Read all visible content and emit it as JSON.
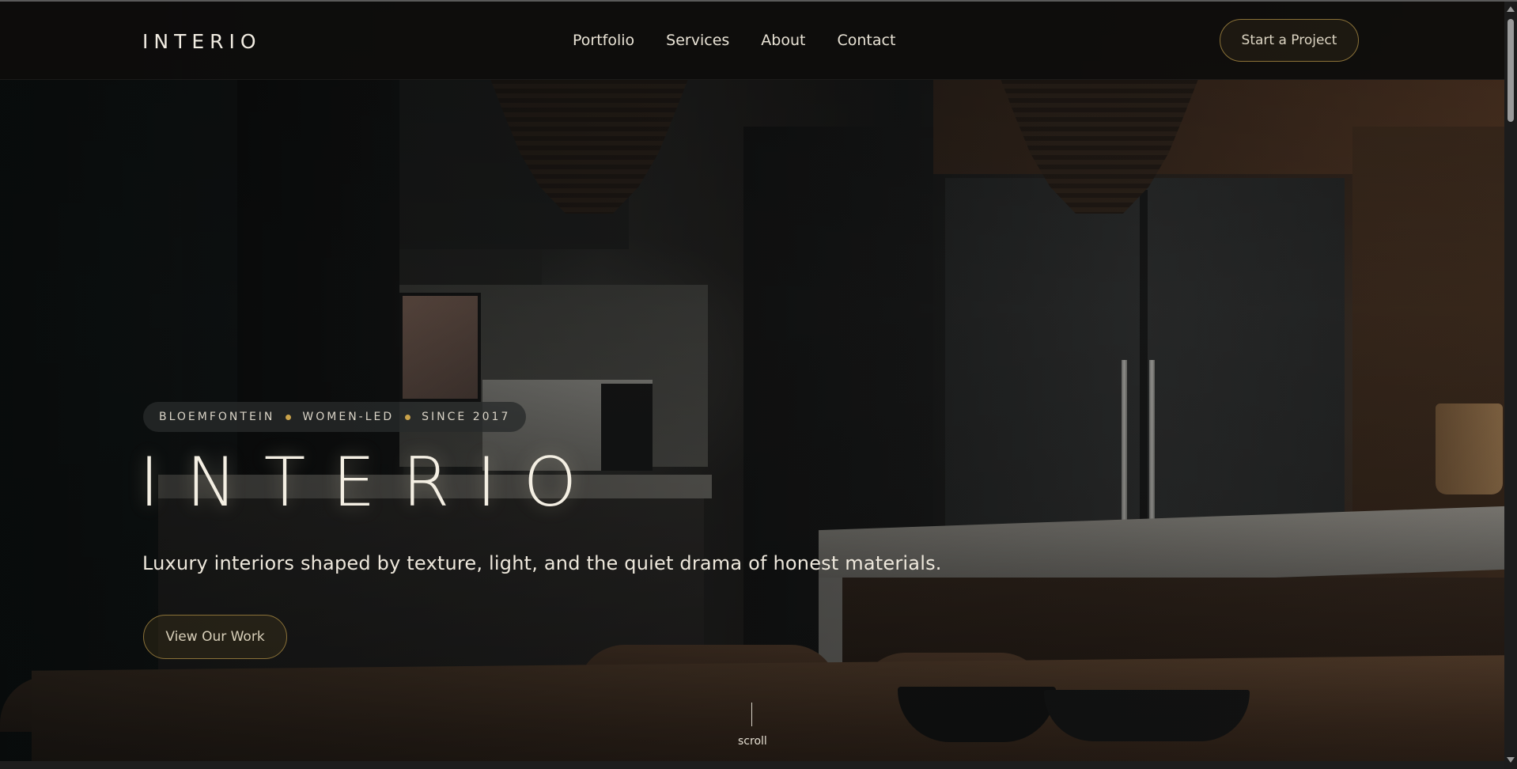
{
  "brand": {
    "name": "INTERIO"
  },
  "nav": {
    "links": [
      {
        "label": "Portfolio"
      },
      {
        "label": "Services"
      },
      {
        "label": "About"
      },
      {
        "label": "Contact"
      }
    ],
    "cta_label": "Start a Project"
  },
  "hero": {
    "badge": {
      "items": [
        "BLOEMFONTEIN",
        "WOMEN-LED",
        "SINCE 2017"
      ]
    },
    "title": "INTERIO",
    "subtitle": "Luxury interiors shaped by texture, light, and the quiet drama of honest materials.",
    "cta_label": "View Our Work",
    "scroll_label": "scroll"
  },
  "colors": {
    "accent_gold": "#c9a24a",
    "button_border": "#8a7138",
    "background": "#141210",
    "text": "#eee7da"
  },
  "icons": {
    "badge_separator": "gold-dot-icon",
    "scroll_indicator": "scroll-line-icon"
  }
}
